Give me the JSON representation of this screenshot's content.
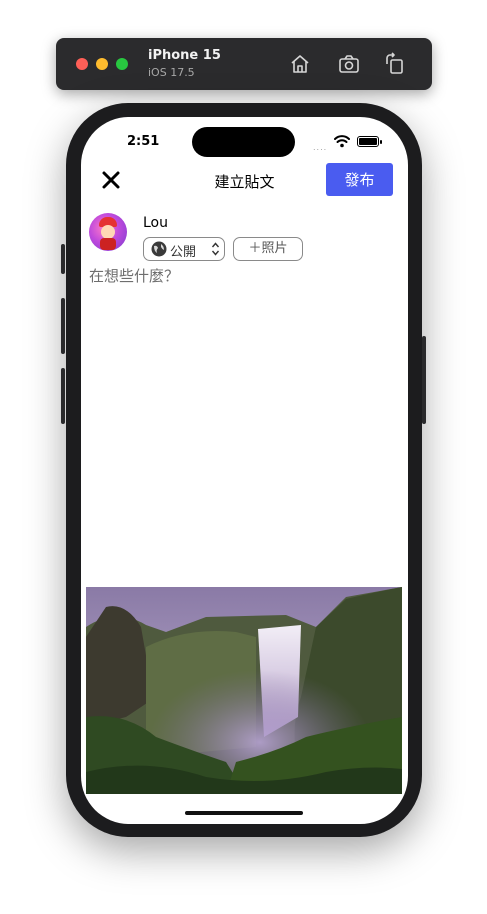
{
  "simulator": {
    "device_name": "iPhone 15",
    "os_version": "iOS 17.5",
    "buttons": {
      "home_icon": "home-icon",
      "screenshot_icon": "camera-icon",
      "rotate_icon": "rotate-icon"
    }
  },
  "status_bar": {
    "time": "2:51",
    "signal_dots": "....",
    "wifi_icon": "wifi-icon",
    "battery_icon": "battery-icon"
  },
  "nav": {
    "close_icon": "close-icon",
    "title": "建立貼文",
    "publish_label": "發布"
  },
  "author": {
    "name": "Lou",
    "avatar": "avatar"
  },
  "privacy": {
    "selected": "公開",
    "icon": "globe-icon"
  },
  "add_photo": {
    "label": "＋照片"
  },
  "composer": {
    "placeholder": "在想些什麼？",
    "value": ""
  },
  "attached_photo": {
    "subject": "waterfall"
  },
  "colors": {
    "accent": "#4a5cf0",
    "text": "#000000",
    "placeholder": "#6e6e6e",
    "border": "#8a8a8a"
  }
}
